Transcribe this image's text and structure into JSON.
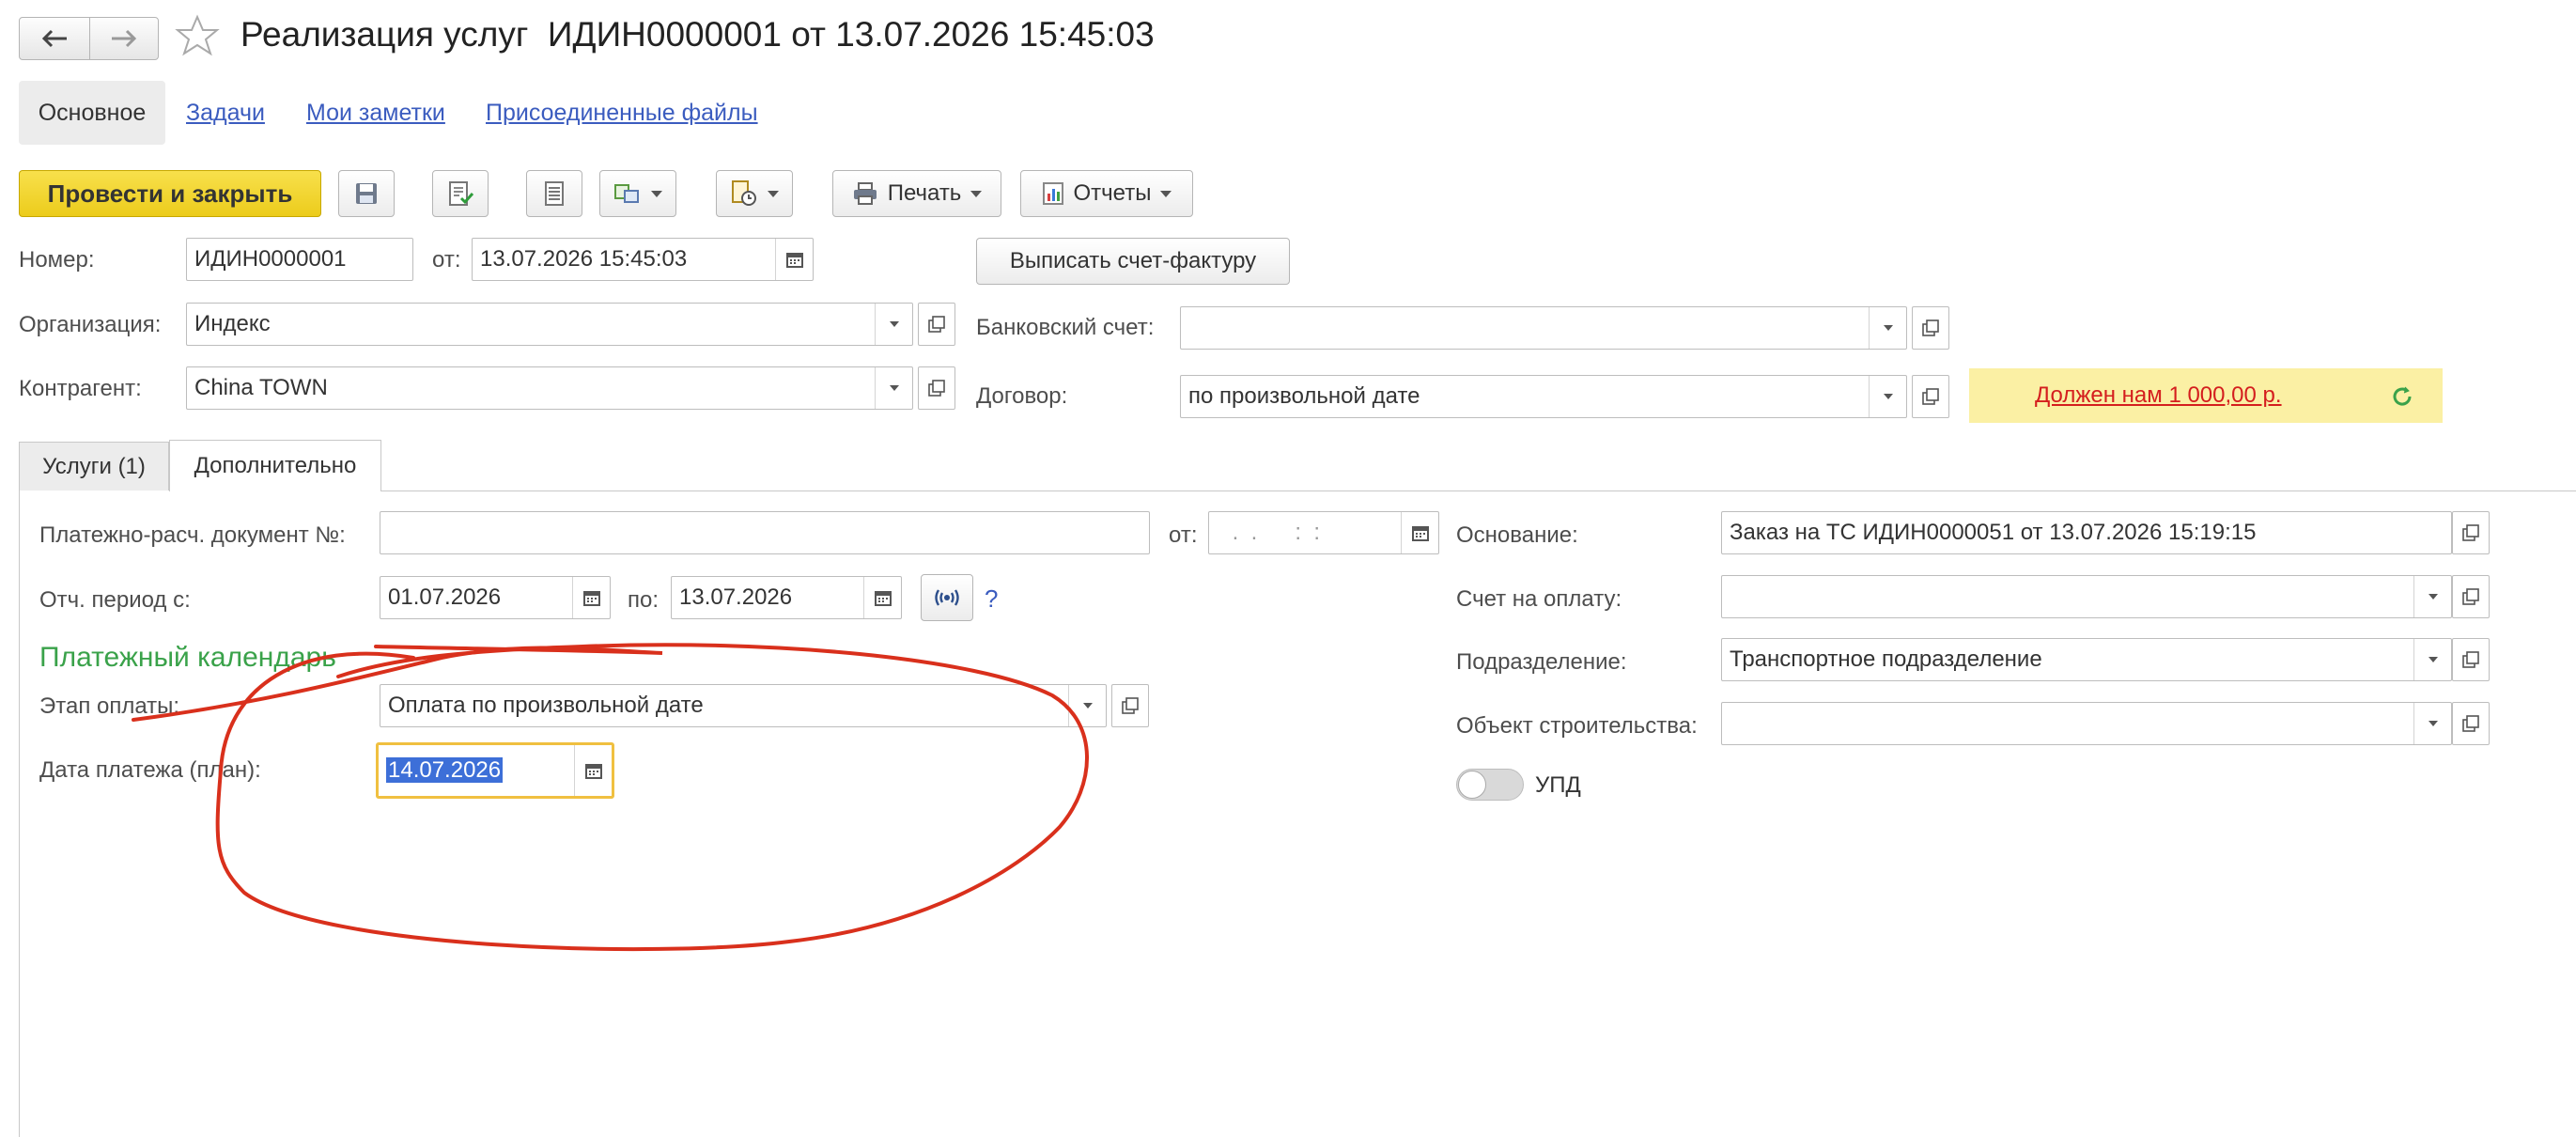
{
  "window": {
    "title": "Реализация услуг  ИДИН0000001 от 13.07.2026 15:45:03"
  },
  "nav_tabs": [
    {
      "label": "Основное"
    },
    {
      "label": "Задачи"
    },
    {
      "label": "Мои заметки"
    },
    {
      "label": "Присоединенные файлы"
    }
  ],
  "toolbar": {
    "post_close_label": "Провести и закрыть",
    "print_label": "Печать",
    "reports_label": "Отчеты",
    "invoice_button_label": "Выписать счет-фактуру"
  },
  "header": {
    "number_label": "Номер:",
    "number_value": "ИДИН0000001",
    "from_label": "от:",
    "date_value": "13.07.2026 15:45:03",
    "org_label": "Организация:",
    "org_value": "Индекс",
    "bank_label": "Банковский счет:",
    "bank_value": "",
    "contractor_label": "Контрагент:",
    "contractor_value": "China TOWN",
    "contract_label": "Договор:",
    "contract_value": "по произвольной дате",
    "debt_text": "Должен нам 1 000,00 р."
  },
  "doc_tabs": [
    {
      "label": "Услуги (1)"
    },
    {
      "label": "Дополнительно"
    }
  ],
  "additional": {
    "payment_doc_label": "Платежно-расч. документ №:",
    "payment_doc_value": "",
    "payment_from_label": "от:",
    "payment_from_value": " .  .      :  :",
    "period_label": "Отч. период с:",
    "period_from": "01.07.2026",
    "period_to_label": "по:",
    "period_to": "13.07.2026",
    "help_label": "?",
    "calendar_heading": "Платежный календарь",
    "stage_label": "Этап оплаты:",
    "stage_value": "Оплата по произвольной дате",
    "plan_date_label": "Дата платежа (план):",
    "plan_date_value": "14.07.2026",
    "basis_label": "Основание:",
    "basis_value": "Заказ на ТС ИДИН0000051 от 13.07.2026 15:19:15",
    "invoice_label": "Счет на оплату:",
    "invoice_value": "",
    "division_label": "Подразделение:",
    "division_value": "Транспортное подразделение",
    "construction_label": "Объект строительства:",
    "construction_value": "",
    "upd_label": "УПД"
  },
  "colors": {
    "primary_button": "#f4d630",
    "debt_background": "#fbf0a4",
    "debt_text": "#d41e1e",
    "calendar_heading": "#3aa24a",
    "link": "#3b5cbf",
    "annotation": "#d9301c",
    "selection": "#3d6fd8",
    "focus_border": "#f0c040"
  }
}
